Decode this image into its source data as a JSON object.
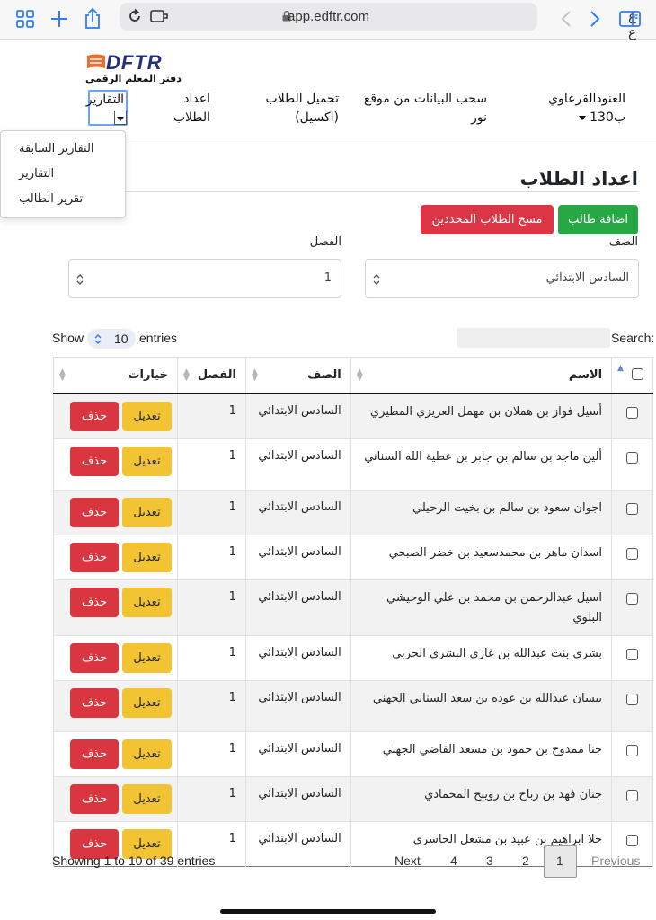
{
  "browser": {
    "url": "app.edftr.com",
    "text_size_label": "ع ع"
  },
  "site": {
    "logo_text": "DFTR",
    "logo_tagline": "دفتر المعلم الرقمي"
  },
  "nav": {
    "school": "العنودالقرعاوي",
    "section": "ب130",
    "pull_noor": "سحب البيانات من موقع نور",
    "upload_students": "تحميل الطلاب (اكسيل)",
    "setup_students": "اعداد الطلاب",
    "reports": "التقارير"
  },
  "reports_menu": [
    "التقارير السابقة",
    "التقارير",
    "تقرير الطالب"
  ],
  "page": {
    "title": "اعداد الطلاب",
    "add_button": "اضافة طالب",
    "clear_button": "مسح الطلاب المحددين",
    "grade_label": "الصف",
    "grade_value": "السادس الابتدائي",
    "class_label": "الفصل",
    "class_value": "1"
  },
  "table_controls": {
    "show": "Show",
    "page_length": "10",
    "entries": "entries",
    "search_label": "Search:"
  },
  "columns": {
    "name": "الاسم",
    "grade": "الصف",
    "class": "الفصل",
    "actions": "خيارات"
  },
  "rows": [
    {
      "name": "أسيل فواز بن هملان بن مهمل العزيزي المطيري",
      "grade": "السادس الابتدائي",
      "class": "1",
      "edit": "تعديل",
      "delete": "حذف"
    },
    {
      "name": "ألين ماجد بن سالم بن جابر بن عطية الله السناني",
      "grade": "السادس الابتدائي",
      "class": "1",
      "edit": "تعديل",
      "delete": "حذف"
    },
    {
      "name": "اجوان سعود بن سالم بن بخيت الرحيلي",
      "grade": "السادس الابتدائي",
      "class": "1",
      "edit": "تعديل",
      "delete": "حذف"
    },
    {
      "name": "اسدان ماهر بن محمدسعيد بن خضر الصبحي",
      "grade": "السادس الابتدائي",
      "class": "1",
      "edit": "تعديل",
      "delete": "حذف"
    },
    {
      "name": "اسيل عبدالرحمن بن محمد بن علي الوحيشي البلوي",
      "grade": "السادس الابتدائي",
      "class": "1",
      "edit": "تعديل",
      "delete": "حذف"
    },
    {
      "name": "بشرى بنت عبدالله بن غازي البشري الحربي",
      "grade": "السادس الابتدائي",
      "class": "1",
      "edit": "تعديل",
      "delete": "حذف"
    },
    {
      "name": "بيسان عبدالله بن عوده بن سعد السناني الجهني",
      "grade": "السادس الابتدائي",
      "class": "1",
      "edit": "تعديل",
      "delete": "حذف"
    },
    {
      "name": "جنا ممدوح بن حمود بن مسعد القاضي الجهني",
      "grade": "السادس الابتدائي",
      "class": "1",
      "edit": "تعديل",
      "delete": "حذف"
    },
    {
      "name": "جنان فهد بن رباح بن رويبح المحمادي",
      "grade": "السادس الابتدائي",
      "class": "1",
      "edit": "تعديل",
      "delete": "حذف"
    },
    {
      "name": "حلا ابراهيم بن عبيد بن مشعل الحاسري",
      "grade": "السادس الابتدائي",
      "class": "1",
      "edit": "تعديل",
      "delete": "حذف"
    }
  ],
  "footer": {
    "info": "Showing 1 to 10 of 39 entries",
    "previous": "Previous",
    "pages": [
      "1",
      "2",
      "3",
      "4"
    ],
    "next": "Next"
  },
  "colors": {
    "green": "#28a745",
    "red": "#dc3545",
    "yellow": "#f2c434",
    "accent": "#2f7cf6"
  }
}
